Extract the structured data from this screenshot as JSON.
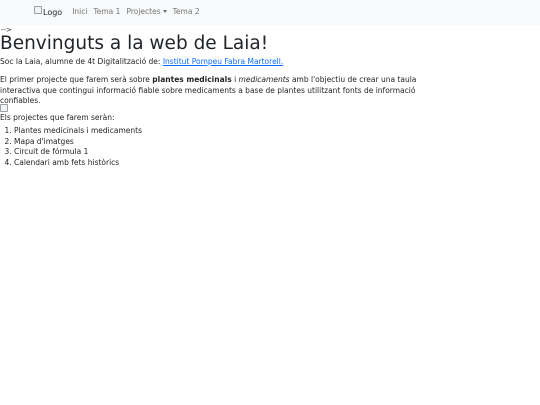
{
  "navbar": {
    "logo_alt": "Logo",
    "items": [
      {
        "label": "Inici"
      },
      {
        "label": "Tema 1"
      },
      {
        "label": "Projectes"
      },
      {
        "label": "Tema 2"
      }
    ]
  },
  "page": {
    "stray_text": "-->",
    "title": "Benvinguts a la web de Laia!",
    "intro_text": "Soc la Laia, alumne de 4t Digitalització de: ",
    "school_link": "Institut Pompeu Fabra Martorell.",
    "project_p": {
      "t1": "El primer projecte que farem serà sobre ",
      "bold": "plantes medicinals",
      "t2": " i ",
      "em": "medicaments",
      "t3": " amb l'objectiu de crear una taula interactiva que contingui informació fiable sobre medicaments a base de plantes utilitzant fonts de informació confiables."
    },
    "projects_heading": "Els projectes que farem seràn:",
    "projects": [
      "Plantes medicinals i medicaments",
      "Mapa d'imatges",
      "Circuit de fórmula 1",
      "Calendari amb fets històrics"
    ]
  }
}
